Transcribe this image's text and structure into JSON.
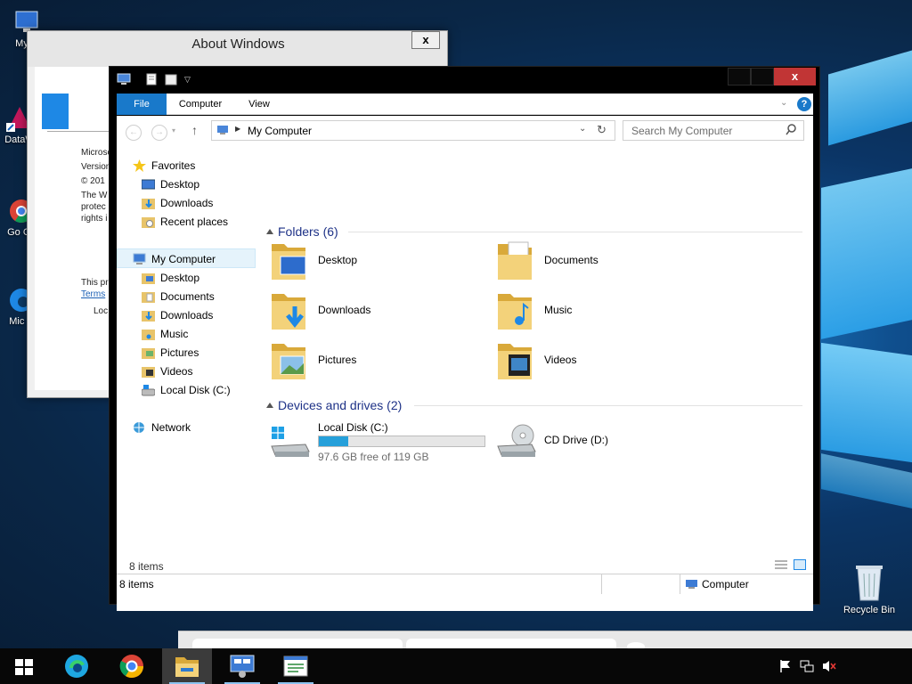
{
  "desktop": {
    "icons": [
      {
        "label": "My C",
        "icon": "my-computer-icon"
      },
      {
        "label": "DataW",
        "icon": "datawave-shortcut-icon"
      },
      {
        "label": "Go Ch",
        "icon": "chrome-shortcut-icon"
      },
      {
        "label": "Mic E",
        "icon": "edge-shortcut-icon"
      },
      {
        "label": "Recycle Bin",
        "icon": "recycle-bin-icon"
      }
    ]
  },
  "about": {
    "title": "About Windows",
    "close": "x",
    "lines": [
      "Microso",
      "Version",
      "© 201",
      "The W",
      "protec",
      "rights i",
      "This pr",
      "Terms",
      "Loc"
    ]
  },
  "explorer": {
    "close": "x",
    "ribbon_tabs": [
      "File",
      "Computer",
      "View"
    ],
    "address": "My Computer",
    "search_placeholder": "Search My Computer",
    "nav": {
      "favorites": {
        "label": "Favorites",
        "items": [
          "Desktop",
          "Downloads",
          "Recent places"
        ]
      },
      "computer": {
        "label": "My Computer",
        "items": [
          "Desktop",
          "Documents",
          "Downloads",
          "Music",
          "Pictures",
          "Videos",
          "Local Disk (C:)"
        ]
      },
      "network": "Network"
    },
    "folders_header": "Folders (6)",
    "folders": [
      "Desktop",
      "Documents",
      "Downloads",
      "Music",
      "Pictures",
      "Videos"
    ],
    "drives_header": "Devices and drives (2)",
    "drives": [
      {
        "name": "Local Disk (C:)",
        "free": "97.6 GB free of 119 GB",
        "used_fraction": 0.18,
        "icon": "hard-drive-icon"
      },
      {
        "name": "CD Drive (D:)",
        "icon": "cd-drive-icon"
      }
    ],
    "status_items": "8 items",
    "status2_items": "8 items",
    "status2_location": "Computer"
  },
  "taskbar": {
    "apps": [
      "start",
      "edge",
      "chrome",
      "file-explorer",
      "control-panel",
      "notepad"
    ]
  },
  "colors": {
    "accent": "#1979ca",
    "close": "#c13535",
    "group_header": "#1e3287",
    "drive_bar": "#26a0da"
  }
}
